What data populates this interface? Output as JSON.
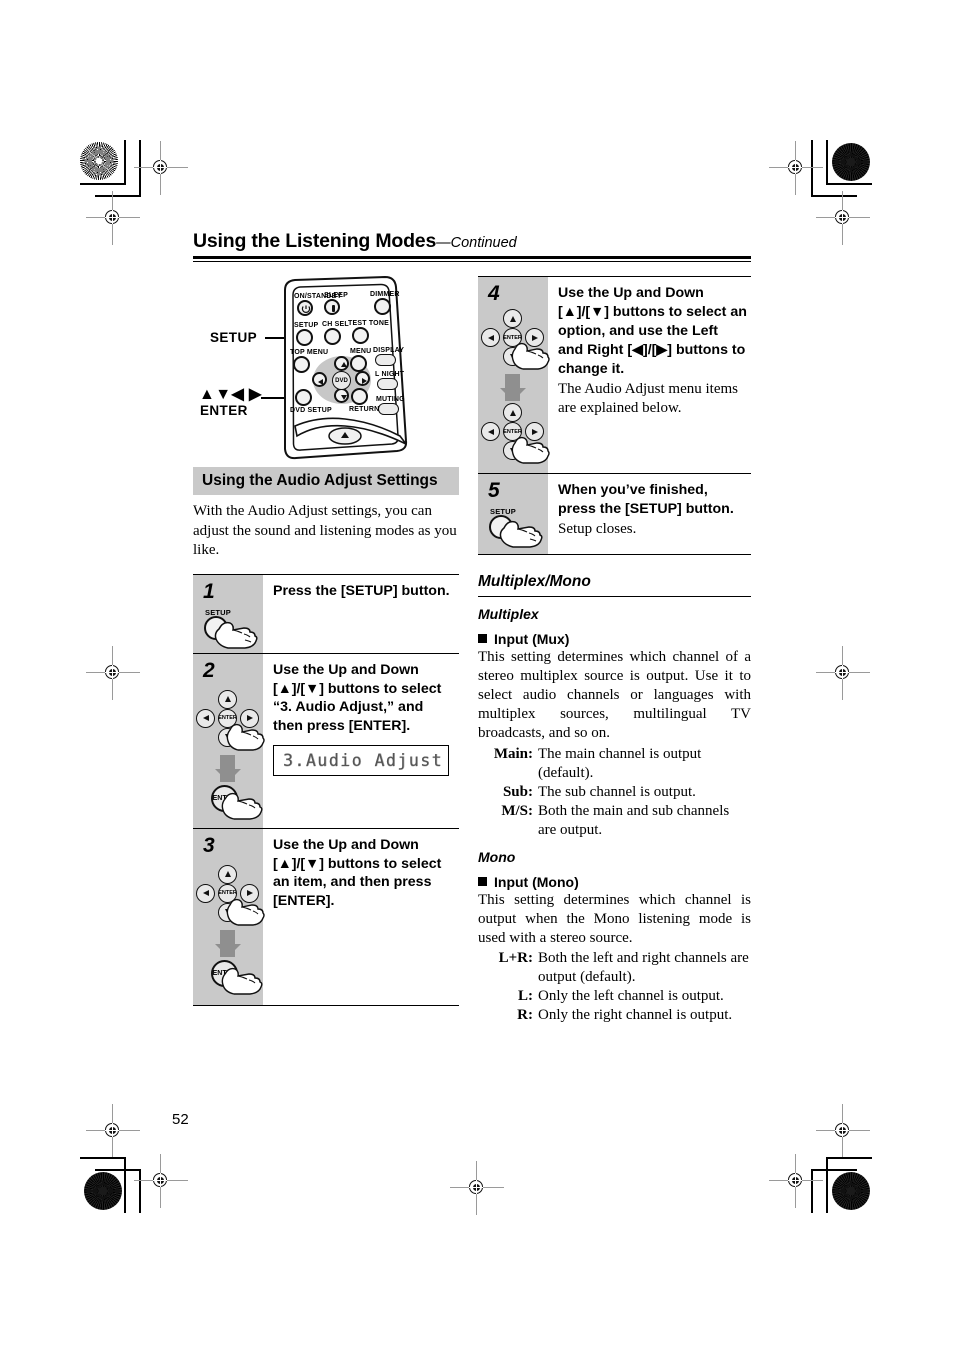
{
  "page": {
    "number": "52",
    "header_title": "Using the Listening Modes",
    "header_continued": "—Continued"
  },
  "remote": {
    "callout_setup": "SETUP",
    "callout_arrows": "▲▼◀ ▶",
    "callout_enter": "ENTER",
    "buttons": {
      "on_standby": "ON/STANDBY",
      "sleep": "SLEEP",
      "dimmer": "DIMMER",
      "setup": "SETUP",
      "ch_sel": "CH SEL",
      "test_tone": "TEST TONE",
      "top_menu": "TOP MENU",
      "menu": "MENU",
      "display": "DISPLAY",
      "l_night": "L NIGHT",
      "muting": "MUTING",
      "dvd_setup": "DVD SETUP",
      "return": "RETURN",
      "center": "DVD",
      "enter": "ENTER"
    }
  },
  "audio_adjust": {
    "section_title": "Using the Audio Adjust Settings",
    "intro": "With the Audio Adjust settings, you can adjust the sound and listening modes as you like.",
    "steps": [
      {
        "num": "1",
        "bold": "Press the [SETUP] button.",
        "note": "",
        "art": "setup-press",
        "button_label": "SETUP"
      },
      {
        "num": "2",
        "bold": "Use the Up and Down [▲]/[▼] buttons to select “3. Audio Adjust,” and then press [ENTER].",
        "note": "",
        "art": "dpad-then-enter",
        "lcd": "3.Audio Adjust"
      },
      {
        "num": "3",
        "bold": "Use the Up and Down [▲]/[▼] buttons to select an item, and then press [ENTER].",
        "note": "",
        "art": "dpad-then-enter"
      },
      {
        "num": "4",
        "bold": "Use the Up and Down [▲]/[▼] buttons to select an option, and use the Left and Right [◀]/[▶] buttons to change it.",
        "note": "The Audio Adjust menu items are explained below.",
        "art": "dpad-then-dpad"
      },
      {
        "num": "5",
        "bold": "When you’ve finished, press the [SETUP] button.",
        "note": "Setup closes.",
        "art": "setup-press",
        "button_label": "SETUP"
      }
    ]
  },
  "multiplex_mono": {
    "title": "Multiplex/Mono",
    "multiplex": {
      "heading": "Multiplex",
      "item": "Input (Mux)",
      "para": "This setting determines which channel of a stereo multiplex source is output. Use it to select audio channels or languages with multiplex sources, multilingual TV broadcasts, and so on.",
      "defs": [
        {
          "term": "Main:",
          "desc": "The main channel is output (default)."
        },
        {
          "term": "Sub:",
          "desc": "The sub channel is output."
        },
        {
          "term": "M/S:",
          "desc": "Both the main and sub channels are output."
        }
      ]
    },
    "mono": {
      "heading": "Mono",
      "item": "Input (Mono)",
      "para": "This setting determines which channel is output when the Mono listening mode is used with a stereo source.",
      "defs": [
        {
          "term": "L+R:",
          "desc": "Both the left and right channels are output (default)."
        },
        {
          "term": "L:",
          "desc": "Only the left channel is output."
        },
        {
          "term": "R:",
          "desc": "Only the right channel is output."
        }
      ]
    }
  },
  "colors": {
    "grey_panel": "#c9c9c9",
    "arrow_grey": "#8f8f8f",
    "lcd_text": "#555555"
  }
}
